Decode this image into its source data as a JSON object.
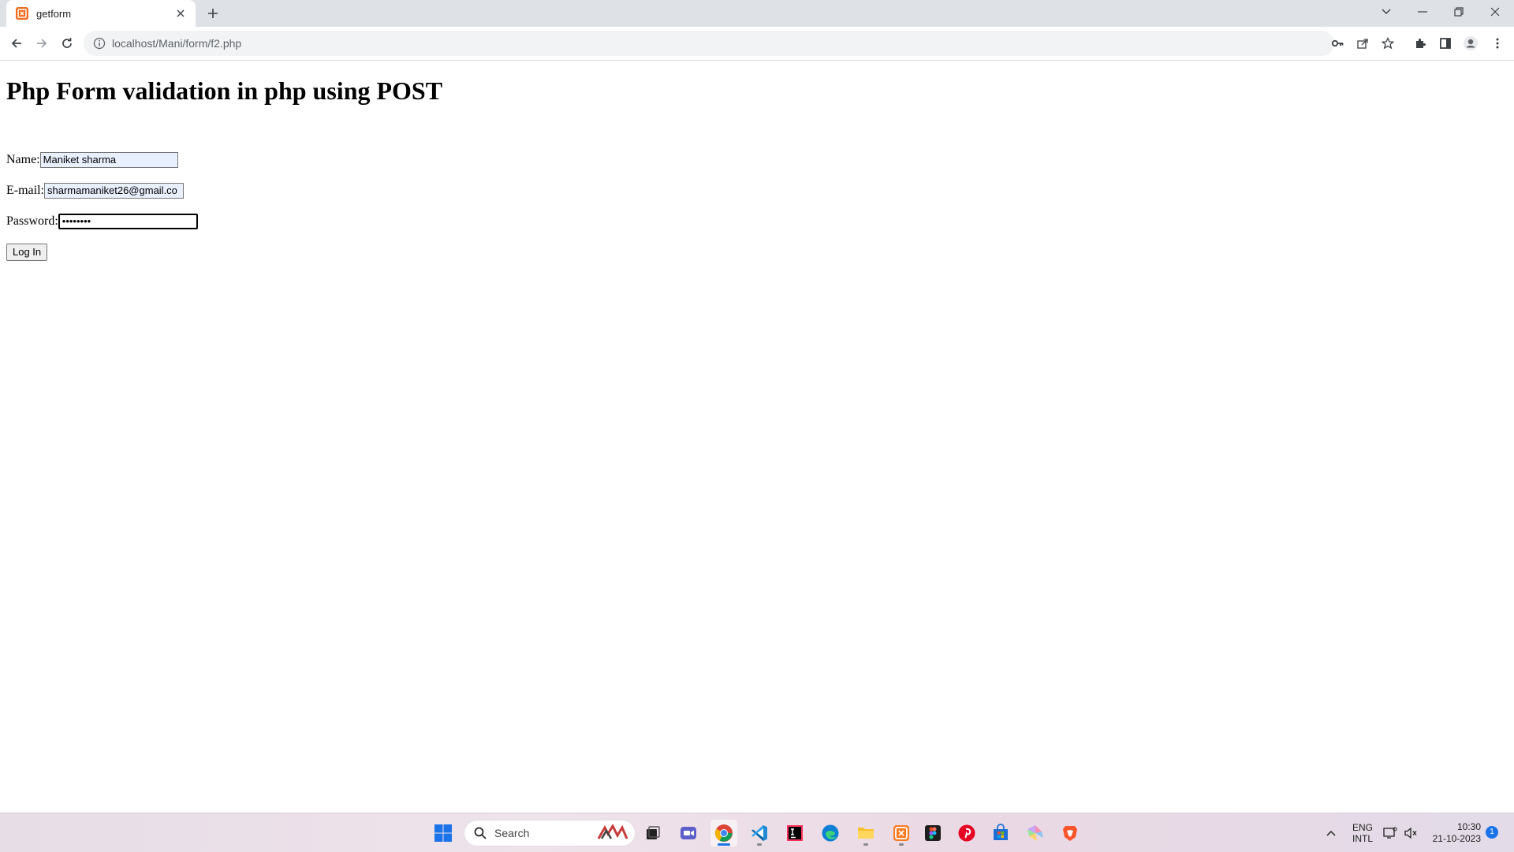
{
  "browser": {
    "tab": {
      "title": "getform",
      "favicon": "xampp-icon"
    },
    "new_tab_icon": "plus-icon",
    "window_controls": [
      "chevron-down-icon",
      "minimize-icon",
      "restore-icon",
      "close-icon"
    ],
    "toolbar": {
      "url": "localhost/Mani/form/f2.php",
      "nav_icons": [
        "back-arrow-icon",
        "forward-arrow-icon",
        "reload-icon"
      ],
      "omnibox_actions": [
        "key-icon",
        "share-icon",
        "star-icon"
      ],
      "extension_icons": [
        "puzzle-icon",
        "side-panel-icon",
        "profile-icon",
        "kebab-menu-icon"
      ]
    }
  },
  "page": {
    "heading": "Php Form validation in php using POST",
    "form": {
      "name_label": "Name:",
      "name_value": "Maniket sharma",
      "email_label": "E-mail:",
      "email_value": "sharmamaniket26@gmail.co",
      "password_label": "Password:",
      "password_masked": "••••••••",
      "submit_label": "Log In"
    }
  },
  "taskbar": {
    "search_placeholder": "Search",
    "apps": [
      "windows-start",
      "search",
      "creators-app",
      "task-view",
      "teams",
      "chrome",
      "vscode",
      "intellij",
      "edge",
      "file-explorer",
      "xampp",
      "figma",
      "pinterest",
      "microsoft-store",
      "drawing-app",
      "brave"
    ],
    "tray": {
      "language_line1": "ENG",
      "language_line2": "INTL",
      "time": "10:30",
      "date": "21-10-2023",
      "notification_count": "1"
    }
  },
  "colors": {
    "tabstrip": "#dee1e6",
    "omnibox": "#f1f3f4",
    "autofill": "#e8f0fe",
    "xampp_orange": "#f26b1d"
  }
}
